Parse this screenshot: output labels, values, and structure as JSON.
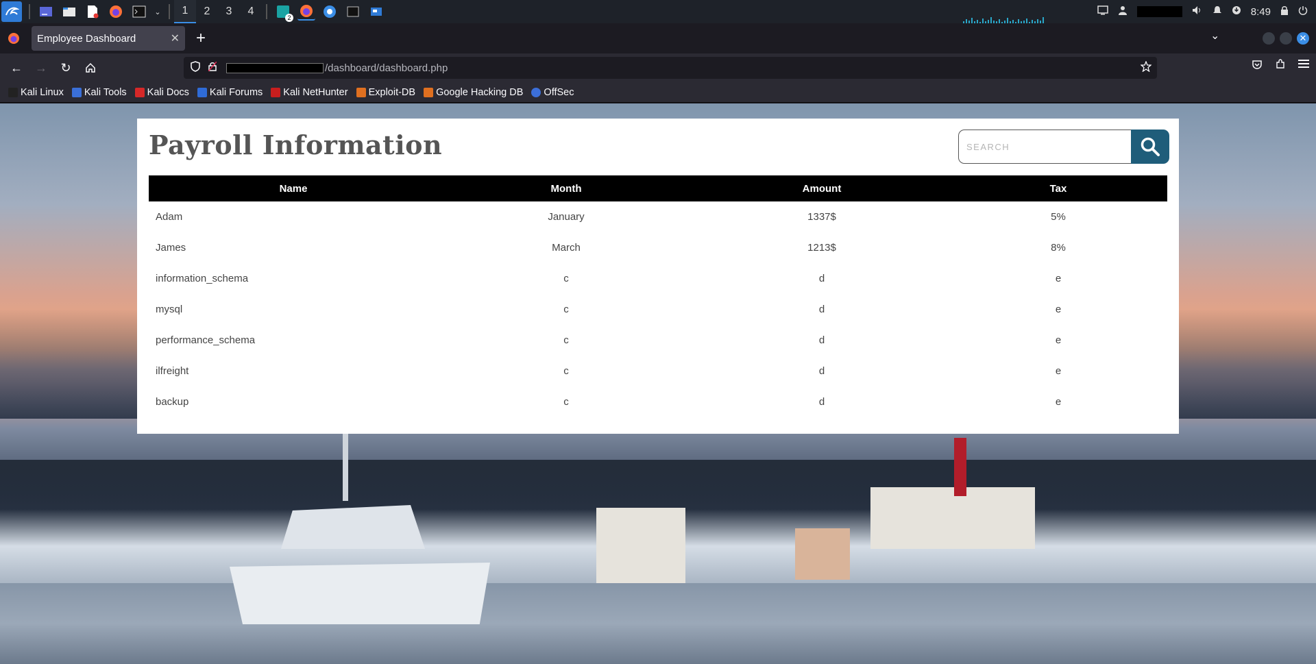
{
  "os_panel": {
    "workspaces": [
      "1",
      "2",
      "3",
      "4"
    ],
    "active_workspace": "1",
    "taskbar_badge": "2",
    "clock": "8:49"
  },
  "browser": {
    "tab_title": "Employee Dashboard",
    "new_tab_label": "+",
    "url_path": "/dashboard/dashboard.php"
  },
  "bookmarks": [
    {
      "label": "Kali Linux",
      "icon": "kali-dragon-icon",
      "color": "#222222"
    },
    {
      "label": "Kali Tools",
      "icon": "kali-tools-icon",
      "color": "#3a6fd8"
    },
    {
      "label": "Kali Docs",
      "icon": "kali-docs-icon",
      "color": "#d62828"
    },
    {
      "label": "Kali Forums",
      "icon": "kali-forums-icon",
      "color": "#2f6bd6"
    },
    {
      "label": "Kali NetHunter",
      "icon": "nethunter-icon",
      "color": "#c81e1e"
    },
    {
      "label": "Exploit-DB",
      "icon": "exploit-db-icon",
      "color": "#e07020"
    },
    {
      "label": "Google Hacking DB",
      "icon": "ghdb-icon",
      "color": "#e07020"
    },
    {
      "label": "OffSec",
      "icon": "offsec-icon",
      "color": "#3c6fd9"
    }
  ],
  "page": {
    "title": "Payroll Information",
    "search": {
      "placeholder": "SEARCH",
      "button_color": "#1f5d7a"
    },
    "table": {
      "columns": [
        "Name",
        "Month",
        "Amount",
        "Tax"
      ],
      "rows": [
        [
          "Adam",
          "January",
          "1337$",
          "5%"
        ],
        [
          "James",
          "March",
          "1213$",
          "8%"
        ],
        [
          "information_schema",
          "c",
          "d",
          "e"
        ],
        [
          "mysql",
          "c",
          "d",
          "e"
        ],
        [
          "performance_schema",
          "c",
          "d",
          "e"
        ],
        [
          "ilfreight",
          "c",
          "d",
          "e"
        ],
        [
          "backup",
          "c",
          "d",
          "e"
        ]
      ]
    }
  }
}
